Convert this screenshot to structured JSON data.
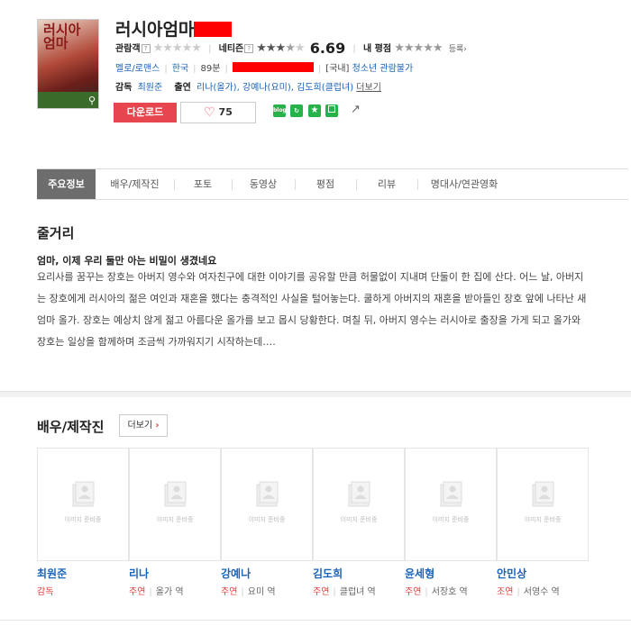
{
  "movie": {
    "title": "러시아엄마",
    "poster_text": "러시아 엄마",
    "audience_label": "관람객",
    "netizen_label": "네티즌",
    "netizen_score": "6.69",
    "netizen_stars": 3.5,
    "my_rating_label": "내 평점",
    "register_label": "등록",
    "genre": "멜로/로맨스",
    "country": "한국",
    "runtime": "89분",
    "rating_prefix": "[국내]",
    "rating": "청소년 관람불가",
    "director_label": "감독",
    "director": "최원준",
    "cast_label": "출연",
    "cast_text": "리나(올가), 강예나(요미), 김도희(클럽녀)",
    "cast_more": "더보기",
    "download_label": "다운로드",
    "like_count": "75",
    "share_icons": [
      "blog",
      "band",
      "star",
      "frame",
      "share"
    ]
  },
  "tabs": [
    {
      "label": "주요정보",
      "active": true
    },
    {
      "label": "배우/제작진"
    },
    {
      "label": "포토"
    },
    {
      "label": "동영상"
    },
    {
      "label": "평점"
    },
    {
      "label": "리뷰"
    },
    {
      "label": "명대사/연관영화"
    }
  ],
  "synopsis": {
    "heading": "줄거리",
    "tagline": "엄마, 이제 우리 둘만 아는 비밀이 생겼네요",
    "body": "요리사를 꿈꾸는 장호는 아버지 영수와 여자친구에 대한 이야기를 공유할 만큼 허물없이 지내며 단둘이 한 집에 산다. 어느 날, 아버지는 장호에게 러시아의 젊은 여인과 재혼을 했다는 충격적인 사실을 털어놓는다. 쿨하게 아버지의 재혼을 받아들인 장호 앞에 나타난 새엄마 올가. 장호는 예상치 않게 젊고 아름다운 올가를 보고 몹시 당황한다. 며칠 뒤, 아버지 영수는 러시아로 출장을 가게 되고 올가와 장호는 일상을 함께하며 조금씩 가까워지기 시작하는데…."
  },
  "crew": {
    "heading": "배우/제작진",
    "more": "더보기",
    "placeholder": "이미지 준비중",
    "people": [
      {
        "name": "최원준",
        "role": "감독",
        "character": ""
      },
      {
        "name": "리나",
        "role": "주연",
        "character": "올가 역"
      },
      {
        "name": "강예나",
        "role": "주연",
        "character": "요미 역"
      },
      {
        "name": "김도희",
        "role": "주연",
        "character": "클럽녀 역"
      },
      {
        "name": "윤세형",
        "role": "주연",
        "character": "서장호 역"
      },
      {
        "name": "안민상",
        "role": "조연",
        "character": "서영수 역"
      }
    ]
  },
  "colors": {
    "accent": "#e8464f",
    "link": "#1a63b8",
    "tab_active": "#6d6d6d",
    "share_green": "#27b24a"
  }
}
